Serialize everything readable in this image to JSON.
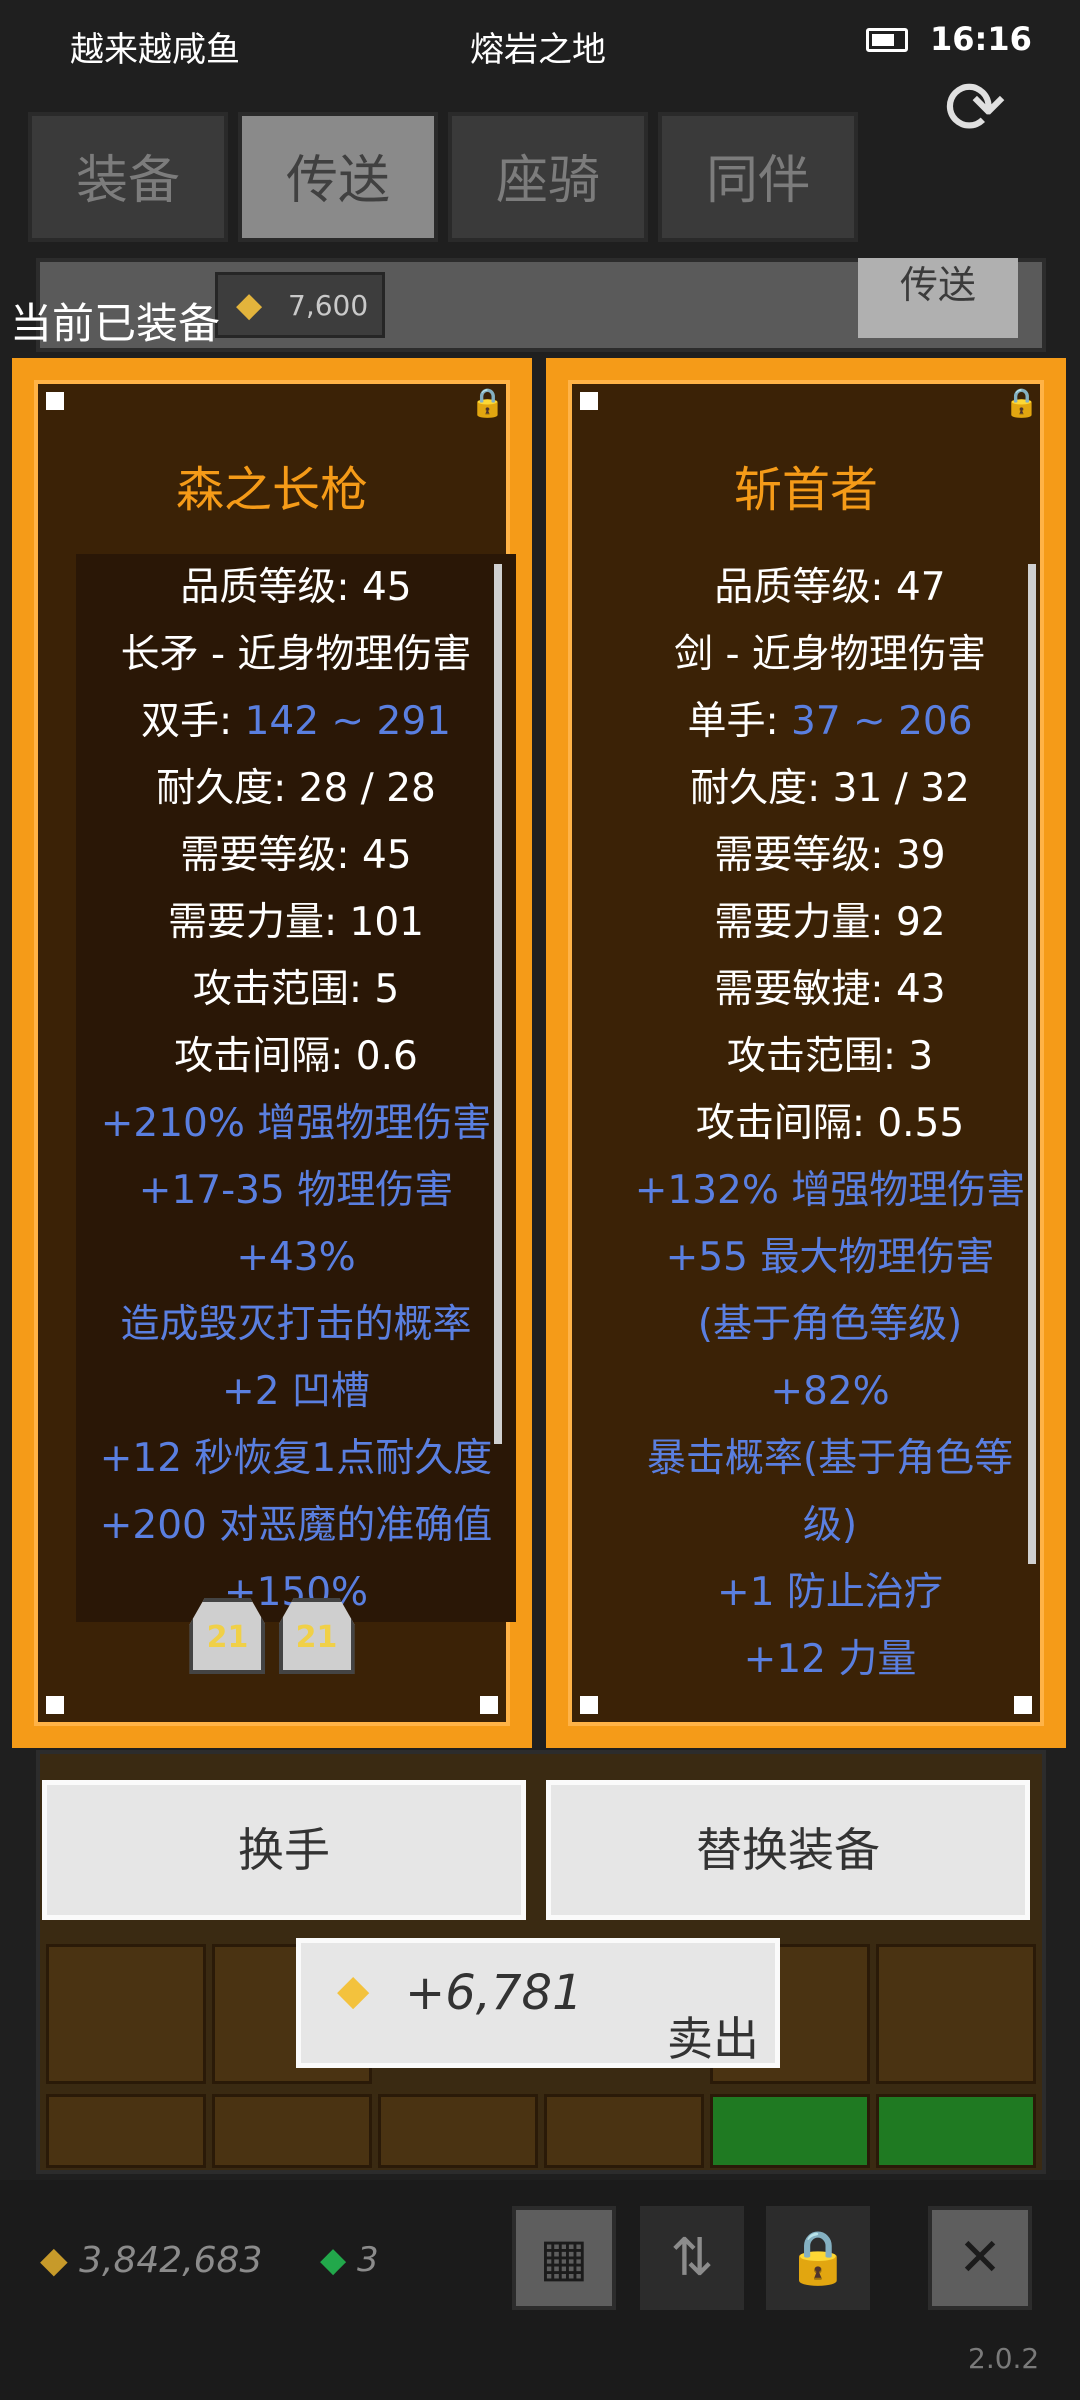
{
  "status": {
    "app_name": "越来越咸鱼",
    "zone": "熔岩之地",
    "time": "16:16"
  },
  "tabs": [
    {
      "label": "装备",
      "active": false
    },
    {
      "label": "传送",
      "active": true
    },
    {
      "label": "座骑",
      "active": false
    },
    {
      "label": "同伴",
      "active": false
    }
  ],
  "header": {
    "coin_value": "7,600",
    "teleport_label": "传送",
    "equipped_label": "当前已装备"
  },
  "left_item": {
    "name": "森之长枪",
    "stats": [
      {
        "text": "品质等级: 45",
        "style": "white"
      },
      {
        "text": "长矛 - 近身物理伤害",
        "style": "white"
      },
      {
        "prefix": "双手: ",
        "value": "142 ~ 291",
        "style": "mixed"
      },
      {
        "text": "耐久度: 28 / 28",
        "style": "white"
      },
      {
        "text": "需要等级: 45",
        "style": "white"
      },
      {
        "text": "需要力量: 101",
        "style": "white"
      },
      {
        "text": "攻击范围: 5",
        "style": "white"
      },
      {
        "text": "攻击间隔: 0.6",
        "style": "white"
      },
      {
        "text": "+210% 增强物理伤害",
        "style": "blue"
      },
      {
        "text": "+17-35 物理伤害",
        "style": "blue"
      },
      {
        "text": "+43%",
        "style": "blue"
      },
      {
        "text": "造成毁灭打击的概率",
        "style": "blue"
      },
      {
        "text": "+2 凹槽",
        "style": "blue"
      },
      {
        "text": "+12 秒恢复1点耐久度",
        "style": "blue"
      },
      {
        "text": "+200 对恶魔的准确值",
        "style": "blue"
      },
      {
        "text": "+150%",
        "style": "blue"
      }
    ],
    "socket_gems": [
      "21",
      "21"
    ]
  },
  "right_item": {
    "name": "斩首者",
    "stats": [
      {
        "text": "品质等级: 47",
        "style": "white"
      },
      {
        "text": "剑 - 近身物理伤害",
        "style": "white"
      },
      {
        "prefix": "单手: ",
        "value": "37 ~ 206",
        "style": "mixed"
      },
      {
        "text": "耐久度: 31 / 32",
        "style": "white"
      },
      {
        "text": "需要等级: 39",
        "style": "white"
      },
      {
        "text": "需要力量: 92",
        "style": "white"
      },
      {
        "text": "需要敏捷: 43",
        "style": "white"
      },
      {
        "text": "攻击范围: 3",
        "style": "white"
      },
      {
        "text": "攻击间隔: 0.55",
        "style": "white"
      },
      {
        "text": "+132% 增强物理伤害",
        "style": "blue"
      },
      {
        "text": "+55 最大物理伤害",
        "style": "blue"
      },
      {
        "text": "(基于角色等级)",
        "style": "blue"
      },
      {
        "text": "+82%",
        "style": "blue"
      },
      {
        "text": "暴击概率(基于角色等",
        "style": "blue"
      },
      {
        "text": "级)",
        "style": "blue"
      },
      {
        "text": "+1 防止治疗",
        "style": "blue"
      },
      {
        "text": "+12 力量",
        "style": "blue"
      }
    ]
  },
  "actions": {
    "swap_hand": "换手",
    "replace_equipment": "替换装备",
    "sell_value": "+6,781",
    "sell_label": "卖出"
  },
  "footer": {
    "gold_total": "3,842,683",
    "gem_total": "3",
    "version": "2.0.2"
  },
  "colors": {
    "accent_orange": "#f59b18",
    "stat_blue": "#5a7fe0",
    "panel_bg": "#3b2206"
  },
  "icons": [
    "battery-icon",
    "refresh-icon",
    "gold-coin-icon",
    "gem-icon",
    "grid-icon",
    "sort-icon",
    "lock-icon",
    "close-icon"
  ]
}
